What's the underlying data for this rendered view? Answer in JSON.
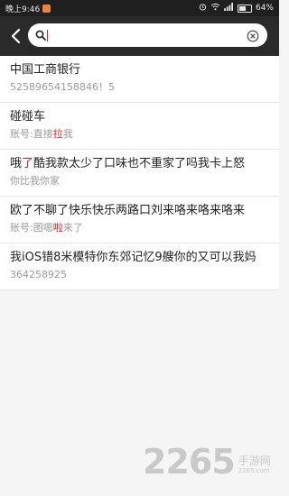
{
  "status_bar": {
    "time": "晚上9:46",
    "battery": "64%"
  },
  "search": {
    "value": "",
    "placeholder": ""
  },
  "results": [
    {
      "title": "中国工商银行",
      "sub": "52589654158846！5",
      "title_parts": [
        "中国工商银行"
      ],
      "sub_parts": [
        "52589654158846！5"
      ]
    },
    {
      "title": "碰碰车",
      "sub_pre": "账号:直接",
      "sub_hl": "拉",
      "sub_post": "我"
    },
    {
      "title_pre": "哦",
      "title_hl": "了",
      "title_post": "酷我款太少了口味也不重家了吗我卡上怒",
      "sub": "你比我你家"
    },
    {
      "title": "欧了不聊了快乐快乐两路口刘来咯来咯来咯来",
      "sub_pre": "账号:图嗯",
      "sub_hl": "啦",
      "sub_post": "来了"
    },
    {
      "title": "我iOS错8米模特你东郊记忆9艘你的又可以我妈",
      "sub": "364258925"
    }
  ],
  "watermark": {
    "number": "2265",
    "cn": "手游网",
    "domain": "2265.com"
  },
  "colors": {
    "header_bg": "#2a2a2a",
    "highlight": "#d81b1b",
    "page_bg": "#f5f5f5"
  },
  "icons": [
    "back-arrow-icon",
    "search-icon",
    "clear-icon",
    "wifi-icon",
    "signal-icon",
    "battery-icon",
    "alarm-icon"
  ]
}
